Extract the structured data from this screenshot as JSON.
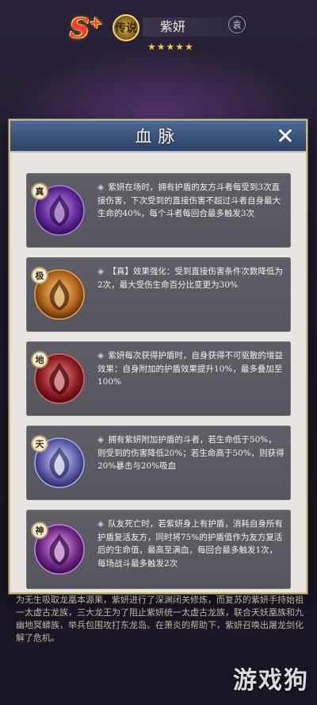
{
  "header": {
    "rank": "S",
    "rank_plus": "+",
    "rarity": "传说",
    "hero_name": "紫妍",
    "stars": "★★★★★",
    "corner_icon": "袁"
  },
  "panel": {
    "title": "血脉",
    "close_label": "✕"
  },
  "abilities": [
    {
      "tier": "真",
      "color": "#7a3bb8",
      "icon": "purple-flame-emblem",
      "text": "紫妍在场时，拥有护盾的友方斗者每受到3次直接伤害，下次受到的直接伤害不超过斗者自身最大生命的40%，每个斗者每回合最多触发3次"
    },
    {
      "tier": "极",
      "color": "#c57a1f",
      "icon": "orange-flame-emblem",
      "text": "【真】效果强化：受到直接伤害条件次数降低为2次，最大受伤生命百分比变更为30%"
    },
    {
      "tier": "地",
      "color": "#a3252a",
      "icon": "red-flame-emblem",
      "text": "紫妍每次获得护盾时，自身获得不可驱散的增益效果：自身附加的护盾效果提升10%，最多叠加至100%"
    },
    {
      "tier": "天",
      "color": "#6e6fb8",
      "icon": "lavender-flame-emblem",
      "text": "拥有紫妍附加护盾的斗者，若生命低于50%，则受到的伤害降低20%；若生命高于50%，则获得20%暴击与20%吸血"
    },
    {
      "tier": "神",
      "color": "#8a3aa0",
      "icon": "violet-flame-emblem",
      "text": "队友死亡时，若紫妍身上有护盾，消耗自身所有护盾复活友方，同时将75%的护盾值作为友方复活后的生命值，最高至满血，每回合最多触发1次，每场战斗最多触发2次"
    }
  ],
  "story": "为无生吸取龙凰本源果，紫妍进行了深渊闭关修炼，而复苏的紫妍手持始祖一太虚古龙族，三大龙王为了阻止紫妍统一太虚古龙族，联合天妖凰族和九幽地冥蟒族，举兵包围攻打东龙岛。在萧炎的帮助下，紫妍召唤出屠龙剑化解了危机。",
  "watermark": "游戏狗"
}
